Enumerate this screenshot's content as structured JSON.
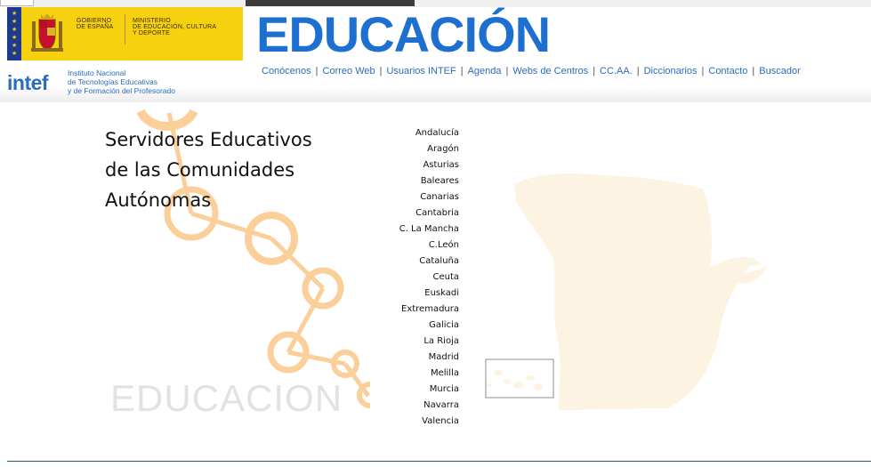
{
  "header": {
    "title": "EDUCACIÓN",
    "gobierno": [
      "GOBIERNO",
      "DE ESPAÑA"
    ],
    "ministerio": [
      "MINISTERIO",
      "DE EDUCACIÓN, CULTURA",
      "Y DEPORTE"
    ],
    "intef_logo": "intef",
    "intef_lines": [
      "Instituto Nacional",
      "de Tecnologías Educativas",
      "y de Formación del Profesorado"
    ]
  },
  "nav": [
    "Conócenos",
    "Correo Web",
    "Usuarios INTEF",
    "Agenda",
    "Webs de Centros",
    "CC.AA.",
    "Diccionarios",
    "Contacto",
    "Buscador"
  ],
  "intro": [
    "Servidores Educativos",
    "de las Comunidades",
    "Autónomas"
  ],
  "watermark": "EDUCACION",
  "regions": [
    "Andalucía",
    "Aragón",
    "Asturias",
    "Baleares",
    "Canarias",
    "Cantabria",
    "C. La Mancha",
    "C.León",
    "Cataluña",
    "Ceuta",
    "Euskadi",
    "Extremadura",
    "Galicia",
    "La Rioja",
    "Madrid",
    "Melilla",
    "Murcia",
    "Navarra",
    "Valencia"
  ],
  "colors": {
    "brand_blue": "#1d6fd0",
    "gov_yellow": "#f6d10f",
    "ring_orange": "#fbcf9a",
    "map_fill": "#fdf3e2"
  }
}
